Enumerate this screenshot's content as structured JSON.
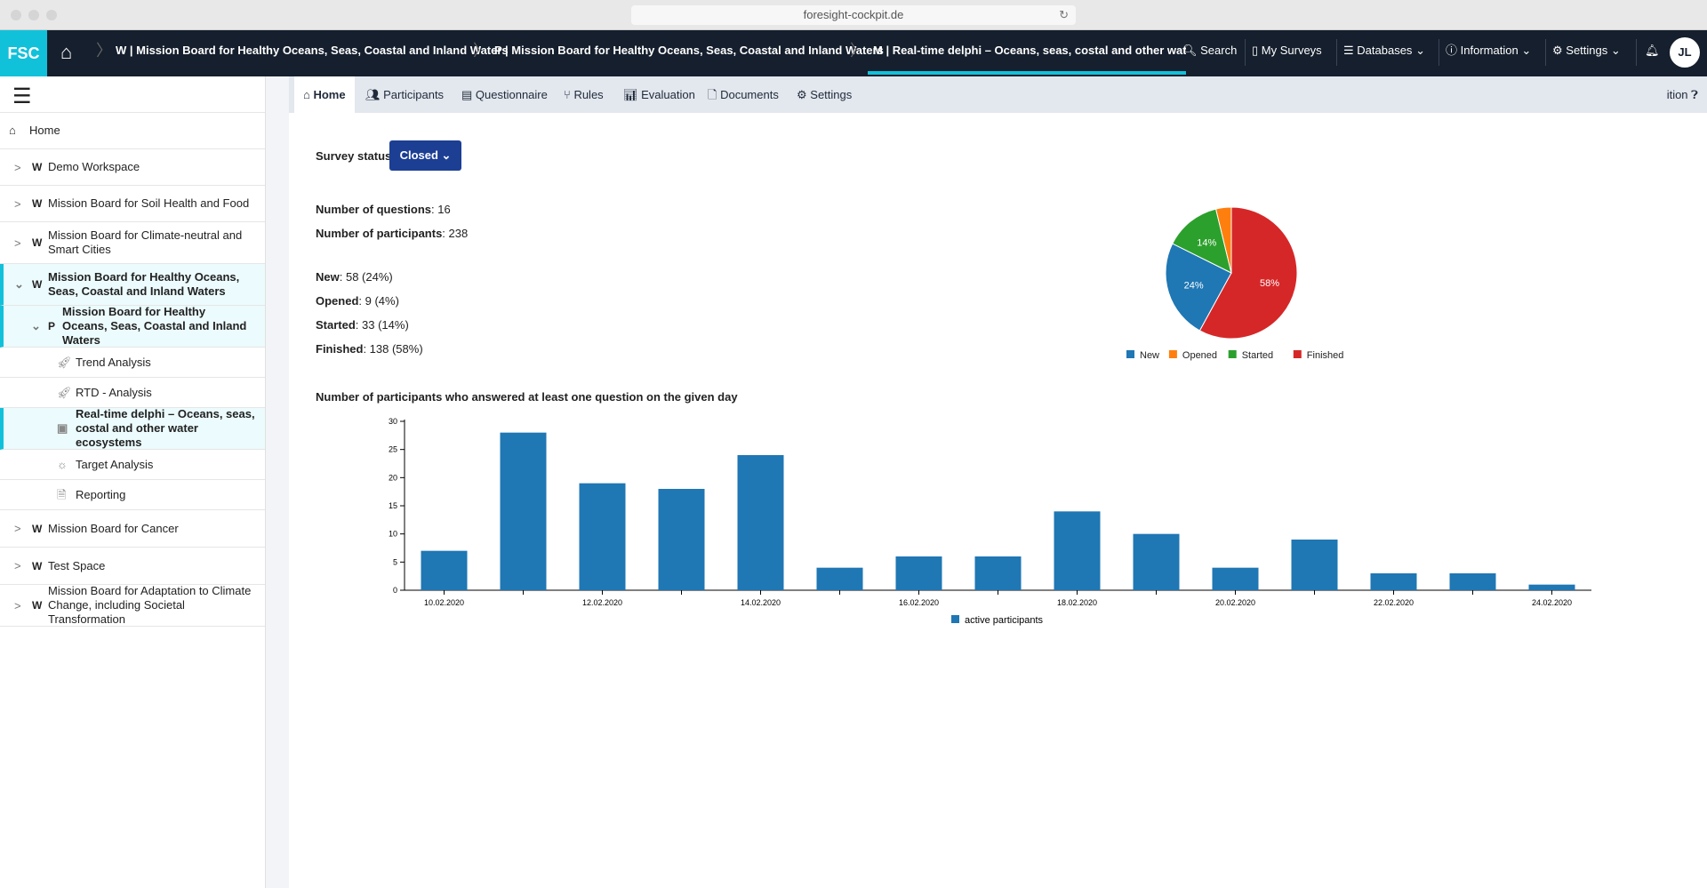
{
  "browser": {
    "url": "foresight-cockpit.de"
  },
  "navbar": {
    "logo": "FSC",
    "breadcrumbs": [
      "W | Mission Board for Healthy Oceans, Seas, Coastal and Inland Waters",
      "P | Mission Board for Healthy Oceans, Seas, Coastal and Inland Waters",
      "M | Real-time delphi – Oceans, seas, costal and other water..."
    ],
    "search": "Search",
    "my_surveys": "My Surveys",
    "databases": "Databases",
    "information": "Information",
    "settings": "Settings",
    "avatar": "JL"
  },
  "sidebar": {
    "home": "Home",
    "items": [
      {
        "type": "W",
        "label": "Demo Workspace"
      },
      {
        "type": "W",
        "label": "Mission Board for Soil Health and Food"
      },
      {
        "type": "W",
        "label": "Mission Board for Climate-neutral and Smart Cities"
      },
      {
        "type": "W",
        "label": "Mission Board for Healthy Oceans, Seas, Coastal and Inland Waters"
      },
      {
        "type": "P",
        "label": "Mission Board for Healthy Oceans, Seas, Coastal and Inland Waters"
      },
      {
        "label": "Trend Analysis"
      },
      {
        "label": "RTD - Analysis"
      },
      {
        "label": "Real-time delphi – Oceans, seas, costal and other water ecosystems"
      },
      {
        "label": "Target Analysis"
      },
      {
        "label": "Reporting"
      },
      {
        "type": "W",
        "label": "Mission Board for Cancer"
      },
      {
        "type": "W",
        "label": "Test Space"
      },
      {
        "type": "W",
        "label": "Mission Board for Adaptation to Climate Change, including Societal Transformation"
      }
    ]
  },
  "tabs": [
    "Home",
    "Participants",
    "Questionnaire",
    "Rules",
    "Evaluation",
    "Documents",
    "Settings"
  ],
  "tab_right": "ition",
  "main": {
    "survey_status_label": "Survey status:",
    "survey_status": "Closed",
    "questions_label": "Number of questions",
    "questions": ": 16",
    "participants_label": "Number of participants",
    "participants": ": 238",
    "new_label": "New",
    "new": ": 58 (24%)",
    "opened_label": "Opened",
    "opened": ": 9 (4%)",
    "started_label": "Started",
    "started": ": 33 (14%)",
    "finished_label": "Finished",
    "finished": ": 138 (58%)"
  },
  "chart_data": [
    {
      "type": "pie",
      "categories": [
        "Finished",
        "New",
        "Started",
        "Opened"
      ],
      "values": [
        138,
        58,
        33,
        9
      ],
      "labels": [
        "58%",
        "24%",
        "14%",
        ""
      ],
      "colors": {
        "New": "#1f77b4",
        "Opened": "#ff7f0e",
        "Started": "#2ca02c",
        "Finished": "#d62728"
      },
      "legend": [
        "New",
        "Opened",
        "Started",
        "Finished"
      ],
      "legend_placement": "bottom"
    },
    {
      "type": "bar",
      "title": "Number of participants who answered at least one question on the given day",
      "categories": [
        "10.02.2020",
        "11.02.2020",
        "12.02.2020",
        "13.02.2020",
        "14.02.2020",
        "15.02.2020",
        "16.02.2020",
        "17.02.2020",
        "18.02.2020",
        "19.02.2020",
        "20.02.2020",
        "21.02.2020",
        "22.02.2020",
        "23.02.2020",
        "24.02.2020"
      ],
      "tick_labels": [
        "10.02.2020",
        "12.02.2020",
        "14.02.2020",
        "16.02.2020",
        "18.02.2020",
        "20.02.2020",
        "22.02.2020",
        "24.02.2020"
      ],
      "series": [
        {
          "name": "active participants",
          "values": [
            7,
            28,
            19,
            18,
            24,
            4,
            6,
            6,
            14,
            10,
            4,
            9,
            3,
            3,
            1
          ]
        }
      ],
      "yticks": [
        0,
        5,
        10,
        15,
        20,
        25,
        30
      ],
      "ylim": [
        0,
        30
      ],
      "color": "#1f77b4",
      "legend_placement": "bottom",
      "grid": false
    }
  ]
}
